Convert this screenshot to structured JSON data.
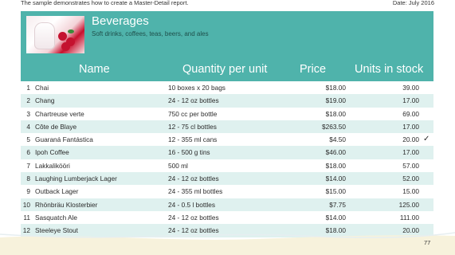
{
  "top": {
    "note": "The sample demonstrates how to create a Master-Detail report.",
    "date": "Date: July 2016"
  },
  "category": {
    "title": "Beverages",
    "description": "Soft drinks, coffees, teas, beers, and ales"
  },
  "columns": {
    "name": "Name",
    "quantity": "Quantity per unit",
    "price": "Price",
    "stock": "Units in stock"
  },
  "rows": [
    {
      "idx": "1",
      "name": "Chai",
      "qty": "10 boxes x 20 bags",
      "price": "$18.00",
      "stock": "39.00",
      "check": ""
    },
    {
      "idx": "2",
      "name": "Chang",
      "qty": "24 - 12 oz bottles",
      "price": "$19.00",
      "stock": "17.00",
      "check": ""
    },
    {
      "idx": "3",
      "name": "Chartreuse verte",
      "qty": "750 cc per bottle",
      "price": "$18.00",
      "stock": "69.00",
      "check": ""
    },
    {
      "idx": "4",
      "name": "Côte de Blaye",
      "qty": "12 - 75 cl bottles",
      "price": "$263.50",
      "stock": "17.00",
      "check": ""
    },
    {
      "idx": "5",
      "name": "Guaraná Fantástica",
      "qty": "12 - 355 ml cans",
      "price": "$4.50",
      "stock": "20.00",
      "check": "✓"
    },
    {
      "idx": "6",
      "name": "Ipoh Coffee",
      "qty": "16 - 500 g tins",
      "price": "$46.00",
      "stock": "17.00",
      "check": ""
    },
    {
      "idx": "7",
      "name": "Lakkalikööri",
      "qty": "500 ml",
      "price": "$18.00",
      "stock": "57.00",
      "check": ""
    },
    {
      "idx": "8",
      "name": "Laughing Lumberjack Lager",
      "qty": "24 - 12 oz bottles",
      "price": "$14.00",
      "stock": "52.00",
      "check": ""
    },
    {
      "idx": "9",
      "name": "Outback Lager",
      "qty": "24 - 355 ml bottles",
      "price": "$15.00",
      "stock": "15.00",
      "check": ""
    },
    {
      "idx": "10",
      "name": "Rhönbräu Klosterbier",
      "qty": "24 - 0.5 l bottles",
      "price": "$7.75",
      "stock": "125.00",
      "check": ""
    },
    {
      "idx": "11",
      "name": "Sasquatch Ale",
      "qty": "24 - 12 oz bottles",
      "price": "$14.00",
      "stock": "111.00",
      "check": ""
    },
    {
      "idx": "12",
      "name": "Steeleye Stout",
      "qty": "24 - 12 oz bottles",
      "price": "$18.00",
      "stock": "20.00",
      "check": ""
    }
  ],
  "page_number": "77",
  "colors": {
    "accent": "#4fb3ab",
    "row_alt": "#dff1ef"
  }
}
